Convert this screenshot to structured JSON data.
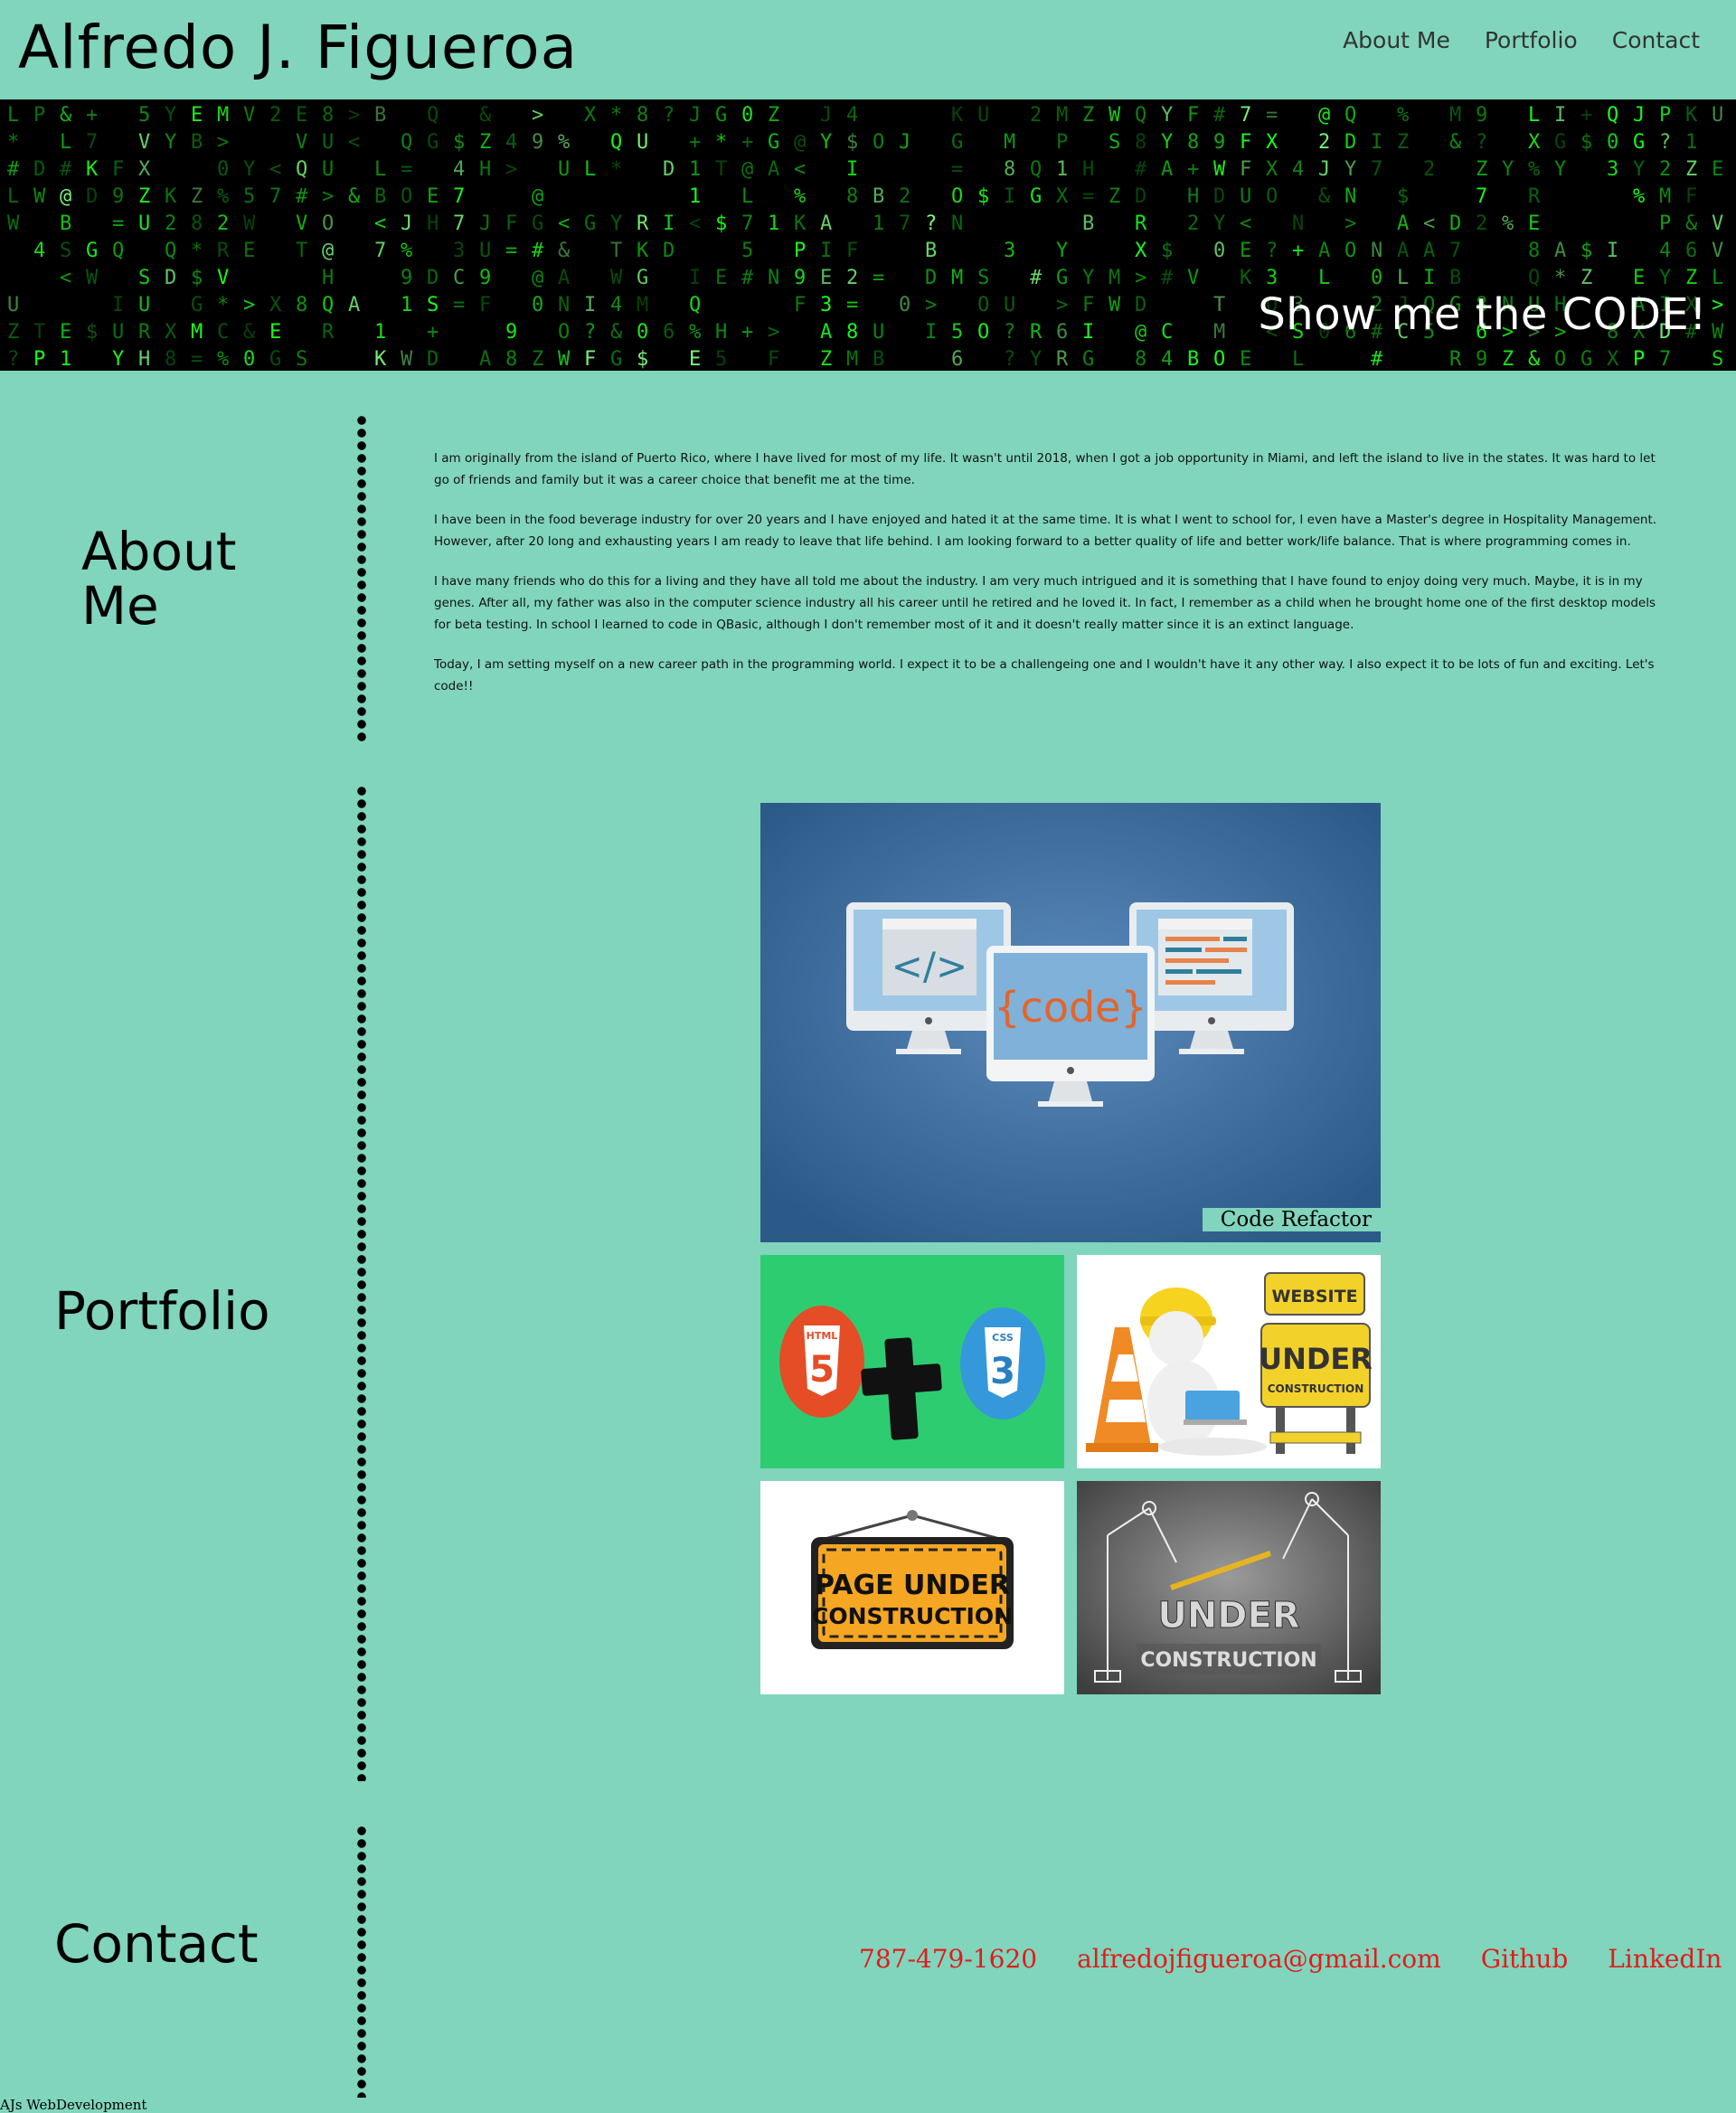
{
  "header": {
    "title": "Alfredo J. Figueroa",
    "nav": [
      "About Me",
      "Portfolio",
      "Contact"
    ]
  },
  "hero": {
    "caption": "Show me the CODE!"
  },
  "about": {
    "heading_line1": "About",
    "heading_line2": "Me",
    "paragraphs": [
      "I am originally from the island of Puerto Rico, where I have lived for most of my life. It wasn't until 2018, when I got a job opportunity in Miami, and left the island to live in the states. It was hard to let go of friends and family but it was a career choice that benefit me at the time.",
      "I have been in the food beverage industry for over 20 years and I have enjoyed and hated it at the same time. It is what I went to school for, I even have a Master's degree in Hospitality Management. However, after 20 long and exhausting years I am ready to leave that life behind. I am looking forward to a better quality of life and better work/life balance. That is where programming comes in.",
      "I have many friends who do this for a living and they have all told me about the industry. I am very much intrigued and it is something that I have found to enjoy doing very much. Maybe, it is in my genes. After all, my father was also in the computer science industry all his career until he retired and he loved it. In fact, I remember as a child when he brought home one of the first desktop models for beta testing. In school I learned to code in QBasic, although I don't remember most of it and it doesn't really matter since it is an extinct language.",
      "Today, I am setting myself on a new career path in the programming world. I expect it to be a challengeing one and I wouldn't have it any other way. I also expect it to be lots of fun and exciting. Let's code!!"
    ]
  },
  "portfolio": {
    "heading": "Portfolio",
    "main_caption": "Code Refactor",
    "main_image_text": "{code}",
    "tiles": [
      {
        "icon": "html5-plus-css3",
        "left_badge": "HTML",
        "right_badge": "CSS"
      },
      {
        "icon": "website-under-construction",
        "sign_line1": "WEBSITE",
        "sign_line2": "UNDER",
        "sign_line3": "CONSTRUCTION"
      },
      {
        "icon": "page-under-construction-sign",
        "line1": "PAGE UNDER",
        "line2": "CONSTRUCTION"
      },
      {
        "icon": "under-construction-robots",
        "line1": "UNDER",
        "line2": "CONSTRUCTION"
      }
    ]
  },
  "contact": {
    "heading": "Contact",
    "phone": "787-479-1620",
    "email": "alfredojfigueroa@gmail.com",
    "github": "Github",
    "linkedin": "LinkedIn"
  },
  "footer": {
    "text": "AJs WebDevelopment"
  },
  "colors": {
    "background": "#80d5bc",
    "link_red": "#e31b1b",
    "matrix_green": "#1cff1c"
  }
}
